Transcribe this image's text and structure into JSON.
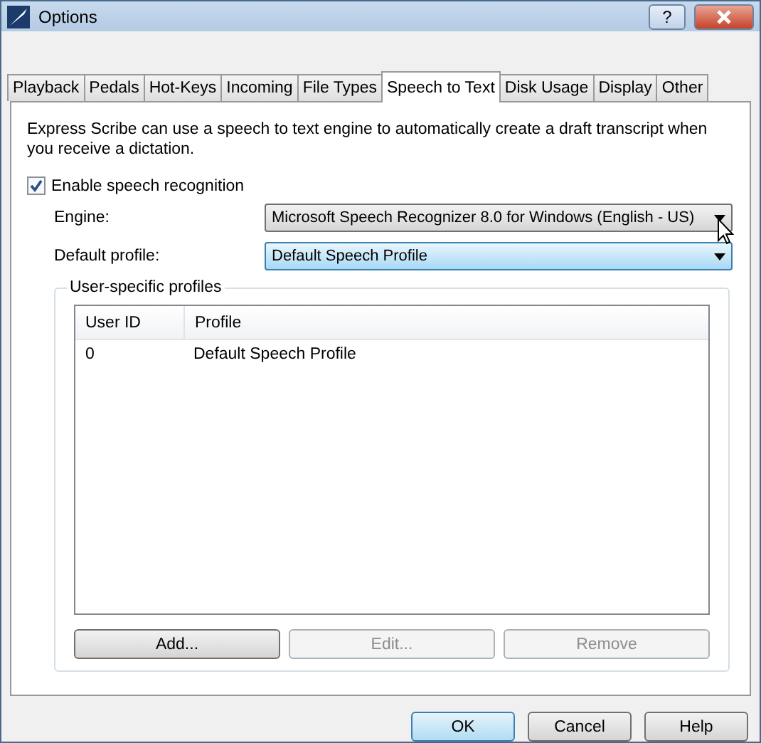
{
  "window": {
    "title": "Options",
    "help_button": "?"
  },
  "tabs": [
    {
      "label": "Playback",
      "selected": false
    },
    {
      "label": "Pedals",
      "selected": false
    },
    {
      "label": "Hot-Keys",
      "selected": false
    },
    {
      "label": "Incoming",
      "selected": false
    },
    {
      "label": "File Types",
      "selected": false
    },
    {
      "label": "Speech to Text",
      "selected": true
    },
    {
      "label": "Disk Usage",
      "selected": false
    },
    {
      "label": "Display",
      "selected": false
    },
    {
      "label": "Other",
      "selected": false
    }
  ],
  "description": "Express Scribe can use a speech to text engine to automatically create a draft transcript when you receive a dictation.",
  "enable_checkbox": {
    "label": "Enable speech recognition",
    "checked": true
  },
  "dropdowns": [
    {
      "label": "Engine:",
      "value": "Microsoft Speech Recognizer 8.0 for Windows (English - US)",
      "highlighted": false
    },
    {
      "label": "Default profile:",
      "value": "Default Speech Profile",
      "highlighted": true
    }
  ],
  "group": {
    "title": "User-specific profiles",
    "table": {
      "columns": [
        "User ID",
        "Profile"
      ],
      "rows": [
        [
          "0",
          "Default Speech Profile"
        ]
      ]
    },
    "buttons": [
      {
        "label": "Add...",
        "disabled": false
      },
      {
        "label": "Edit...",
        "disabled": true
      },
      {
        "label": "Remove",
        "disabled": true
      }
    ]
  },
  "footer_buttons": [
    {
      "label": "OK",
      "default": true
    },
    {
      "label": "Cancel",
      "default": false
    },
    {
      "label": "Help",
      "default": false
    }
  ]
}
